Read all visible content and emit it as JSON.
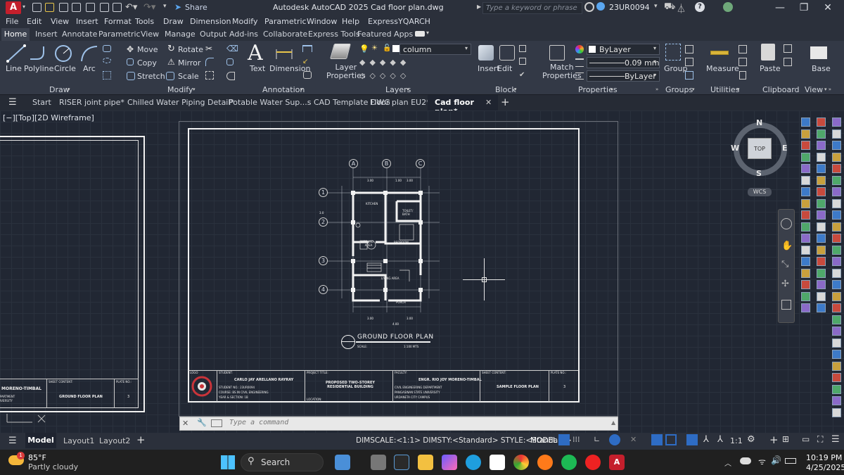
{
  "titlebar": {
    "app_letter": "A",
    "share": "Share",
    "title": "Autodesk AutoCAD 2025   Cad floor plan.dwg",
    "search_placeholder": "Type a keyword or phrase",
    "user": "23UR0094"
  },
  "menu": [
    "File",
    "Edit",
    "View",
    "Insert",
    "Format",
    "Tools",
    "Draw",
    "Dimension",
    "Modify",
    "Parametric",
    "Window",
    "Help",
    "Express",
    "YQARCH"
  ],
  "ribbon_tabs": [
    "Home",
    "Insert",
    "Annotate",
    "Parametric",
    "View",
    "Manage",
    "Output",
    "Add-ins",
    "Collaborate",
    "Express Tools",
    "Featured Apps"
  ],
  "ribbon": {
    "draw": {
      "line": "Line",
      "polyline": "Polyline",
      "circle": "Circle",
      "arc": "Arc",
      "footer": "Draw"
    },
    "modify": {
      "move": "Move",
      "rotate": "Rotate",
      "copy": "Copy",
      "mirror": "Mirror",
      "stretch": "Stretch",
      "scale": "Scale",
      "footer": "Modify"
    },
    "annotation": {
      "text": "Text",
      "dimension": "Dimension",
      "footer": "Annotation"
    },
    "layers": {
      "layer_props": "Layer\nProperties",
      "layer_name": "column",
      "footer": "Layers"
    },
    "block": {
      "insert": "Insert",
      "edit": "Edit",
      "footer": "Block"
    },
    "properties": {
      "match": "Match\nProperties",
      "color": "ByLayer",
      "lineweight": "0.09 mm",
      "linetype": "ByLayer",
      "footer": "Properties"
    },
    "groups": {
      "group": "Group",
      "footer": "Groups"
    },
    "utilities": {
      "measure": "Measure",
      "footer": "Utilities"
    },
    "clipboard": {
      "paste": "Paste",
      "footer": "Clipboard"
    },
    "view": {
      "base": "Base",
      "footer": "View"
    }
  },
  "file_tabs": {
    "start": "Start",
    "tabs": [
      "RISER joint pipe*",
      "Chilled Water Piping Detail*",
      "Potable Water Sup...s CAD Template DWG",
      "Floor plan EU2*"
    ],
    "active": "Cad floor plan*"
  },
  "viewport_label": "[−][Top][2D Wireframe]",
  "viewcube": {
    "n": "N",
    "s": "S",
    "e": "E",
    "w": "W",
    "top": "TOP",
    "wcs": "WCS"
  },
  "drawing": {
    "plan_title": "GROUND FLOOR PLAN",
    "scale": "SCALE:",
    "scale_val": "1:100 MTS",
    "grid_cols": [
      "A",
      "B",
      "C"
    ],
    "grid_rows": [
      "1",
      "2",
      "3",
      "4"
    ],
    "rooms": {
      "kitchen": "KITCHEN",
      "toilet": "TOILET/ BATH",
      "dining": "DINING AREA",
      "bedroom": "BEDROOM",
      "living": "LIVING AREA",
      "porch": "PORCH"
    },
    "dims_top": [
      "3.00",
      "1.00",
      "3.00"
    ],
    "dims_bottom": [
      "3.00",
      "4.00",
      "3.00"
    ],
    "titleblock": {
      "logo": "LOGO",
      "student": "STUDENT:",
      "student_name": "CARLO JAY ARELLANO RAYRAY",
      "student_lines": [
        "STUDENT NO.: 23UR0094",
        "COURSE: BS IN CIVIL ENGINEERING",
        "YEAR & SECTION: 1B"
      ],
      "project_title": "PROJECT TITLE:",
      "project_name": "PROPOSED TWO-STOREY RESIDENTIAL BUILDING",
      "location": "LOCATION:",
      "faculty": "FACULTY:",
      "faculty_name": "ENGR. RIO JOY MORENO-TIMBAL",
      "faculty_lines": [
        "CIVIL ENGINEERING DEPARTMENT",
        "PANGASINAN STATE UNIVERSITY",
        "URDANETA CITY CAMPUS"
      ],
      "sheet_content": "SHEET CONTENT:",
      "sheet_name": "SAMPLE FLOOR PLAN",
      "plate_no": "PLATE NO.:",
      "plate": "3"
    },
    "left_sheet": {
      "name": "MORENO-TIMBAL",
      "dept": "PARTMENT",
      "univ": "IVERSITY",
      "sheet_content": "SHEET CONTENT:",
      "sheet_name": "GROUND FLOOR PLAN",
      "plate_no": "PLATE NO.:",
      "plate": "3"
    }
  },
  "command": {
    "placeholder": "Type a command"
  },
  "layout_tabs": {
    "model": "Model",
    "layout1": "Layout1",
    "layout2": "Layout2"
  },
  "status": {
    "dim": "DIMSCALE:<1:1> DIMSTY:<Standard> STYLE:<Standard>",
    "model": "MODEL",
    "scale": "1:1"
  },
  "taskbar": {
    "temp": "85°F",
    "weather": "Partly cloudy",
    "badge": "1",
    "search": "Search",
    "time": "10:19 PM",
    "date": "4/25/2025"
  }
}
